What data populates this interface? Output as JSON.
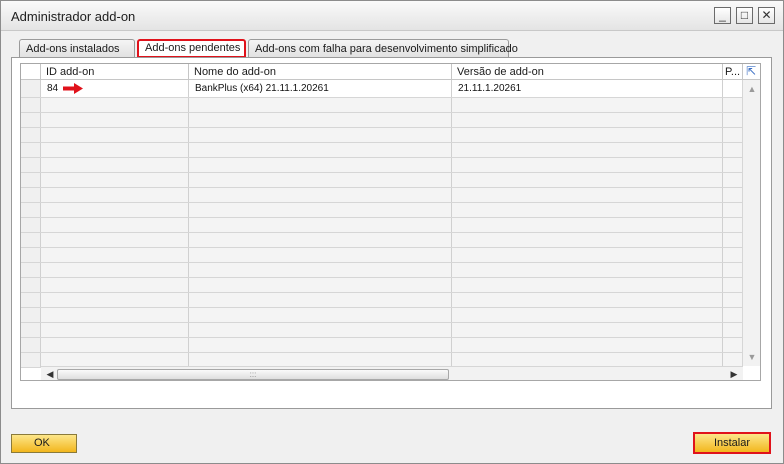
{
  "window": {
    "title": "Administrador add-on"
  },
  "tabs": [
    {
      "label": "Add-ons instalados",
      "active": false
    },
    {
      "label": "Add-ons pendentes",
      "active": true
    },
    {
      "label": "Add-ons com falha para desenvolvimento simplificado",
      "active": false
    }
  ],
  "grid": {
    "columns": [
      "ID add-on",
      "Nome do add-on",
      "Versão de add-on",
      "P..."
    ],
    "rows": [
      {
        "id": "84",
        "name": "BankPlus (x64) 21.11.1.20261",
        "version": "21.11.1.20261",
        "p": ""
      }
    ],
    "empty_row_count": 18
  },
  "buttons": {
    "ok": "OK",
    "install": "Instalar"
  },
  "colors": {
    "highlight_border": "#e0121b",
    "button_fill": "#f2b61d",
    "arrow": "#e0121b"
  },
  "icons": {
    "minimize": "minimize-icon",
    "maximize": "maximize-icon",
    "close": "close-icon",
    "arrow": "right-arrow-icon",
    "expand": "expand-icon"
  }
}
